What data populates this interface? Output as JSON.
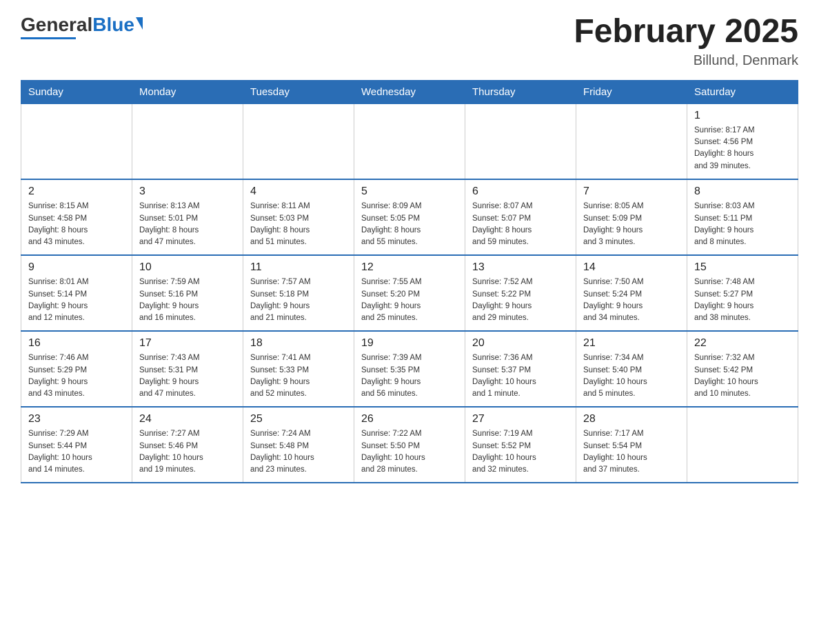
{
  "header": {
    "logo_general": "General",
    "logo_blue": "Blue",
    "title": "February 2025",
    "location": "Billund, Denmark"
  },
  "days_of_week": [
    "Sunday",
    "Monday",
    "Tuesday",
    "Wednesday",
    "Thursday",
    "Friday",
    "Saturday"
  ],
  "weeks": [
    [
      {
        "day": "",
        "info": ""
      },
      {
        "day": "",
        "info": ""
      },
      {
        "day": "",
        "info": ""
      },
      {
        "day": "",
        "info": ""
      },
      {
        "day": "",
        "info": ""
      },
      {
        "day": "",
        "info": ""
      },
      {
        "day": "1",
        "info": "Sunrise: 8:17 AM\nSunset: 4:56 PM\nDaylight: 8 hours\nand 39 minutes."
      }
    ],
    [
      {
        "day": "2",
        "info": "Sunrise: 8:15 AM\nSunset: 4:58 PM\nDaylight: 8 hours\nand 43 minutes."
      },
      {
        "day": "3",
        "info": "Sunrise: 8:13 AM\nSunset: 5:01 PM\nDaylight: 8 hours\nand 47 minutes."
      },
      {
        "day": "4",
        "info": "Sunrise: 8:11 AM\nSunset: 5:03 PM\nDaylight: 8 hours\nand 51 minutes."
      },
      {
        "day": "5",
        "info": "Sunrise: 8:09 AM\nSunset: 5:05 PM\nDaylight: 8 hours\nand 55 minutes."
      },
      {
        "day": "6",
        "info": "Sunrise: 8:07 AM\nSunset: 5:07 PM\nDaylight: 8 hours\nand 59 minutes."
      },
      {
        "day": "7",
        "info": "Sunrise: 8:05 AM\nSunset: 5:09 PM\nDaylight: 9 hours\nand 3 minutes."
      },
      {
        "day": "8",
        "info": "Sunrise: 8:03 AM\nSunset: 5:11 PM\nDaylight: 9 hours\nand 8 minutes."
      }
    ],
    [
      {
        "day": "9",
        "info": "Sunrise: 8:01 AM\nSunset: 5:14 PM\nDaylight: 9 hours\nand 12 minutes."
      },
      {
        "day": "10",
        "info": "Sunrise: 7:59 AM\nSunset: 5:16 PM\nDaylight: 9 hours\nand 16 minutes."
      },
      {
        "day": "11",
        "info": "Sunrise: 7:57 AM\nSunset: 5:18 PM\nDaylight: 9 hours\nand 21 minutes."
      },
      {
        "day": "12",
        "info": "Sunrise: 7:55 AM\nSunset: 5:20 PM\nDaylight: 9 hours\nand 25 minutes."
      },
      {
        "day": "13",
        "info": "Sunrise: 7:52 AM\nSunset: 5:22 PM\nDaylight: 9 hours\nand 29 minutes."
      },
      {
        "day": "14",
        "info": "Sunrise: 7:50 AM\nSunset: 5:24 PM\nDaylight: 9 hours\nand 34 minutes."
      },
      {
        "day": "15",
        "info": "Sunrise: 7:48 AM\nSunset: 5:27 PM\nDaylight: 9 hours\nand 38 minutes."
      }
    ],
    [
      {
        "day": "16",
        "info": "Sunrise: 7:46 AM\nSunset: 5:29 PM\nDaylight: 9 hours\nand 43 minutes."
      },
      {
        "day": "17",
        "info": "Sunrise: 7:43 AM\nSunset: 5:31 PM\nDaylight: 9 hours\nand 47 minutes."
      },
      {
        "day": "18",
        "info": "Sunrise: 7:41 AM\nSunset: 5:33 PM\nDaylight: 9 hours\nand 52 minutes."
      },
      {
        "day": "19",
        "info": "Sunrise: 7:39 AM\nSunset: 5:35 PM\nDaylight: 9 hours\nand 56 minutes."
      },
      {
        "day": "20",
        "info": "Sunrise: 7:36 AM\nSunset: 5:37 PM\nDaylight: 10 hours\nand 1 minute."
      },
      {
        "day": "21",
        "info": "Sunrise: 7:34 AM\nSunset: 5:40 PM\nDaylight: 10 hours\nand 5 minutes."
      },
      {
        "day": "22",
        "info": "Sunrise: 7:32 AM\nSunset: 5:42 PM\nDaylight: 10 hours\nand 10 minutes."
      }
    ],
    [
      {
        "day": "23",
        "info": "Sunrise: 7:29 AM\nSunset: 5:44 PM\nDaylight: 10 hours\nand 14 minutes."
      },
      {
        "day": "24",
        "info": "Sunrise: 7:27 AM\nSunset: 5:46 PM\nDaylight: 10 hours\nand 19 minutes."
      },
      {
        "day": "25",
        "info": "Sunrise: 7:24 AM\nSunset: 5:48 PM\nDaylight: 10 hours\nand 23 minutes."
      },
      {
        "day": "26",
        "info": "Sunrise: 7:22 AM\nSunset: 5:50 PM\nDaylight: 10 hours\nand 28 minutes."
      },
      {
        "day": "27",
        "info": "Sunrise: 7:19 AM\nSunset: 5:52 PM\nDaylight: 10 hours\nand 32 minutes."
      },
      {
        "day": "28",
        "info": "Sunrise: 7:17 AM\nSunset: 5:54 PM\nDaylight: 10 hours\nand 37 minutes."
      },
      {
        "day": "",
        "info": ""
      }
    ]
  ]
}
